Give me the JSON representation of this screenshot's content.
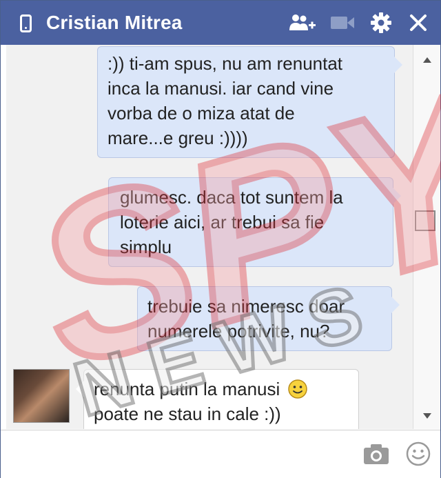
{
  "header": {
    "contact_name": "Cristian Mitrea",
    "icons": [
      "phone-icon",
      "add-friend-icon",
      "video-icon",
      "gear-icon",
      "close-icon"
    ]
  },
  "messages": [
    {
      "direction": "outgoing",
      "lines": [
        ":)) ti-am spus, nu am renuntat",
        "inca la manusi. iar cand vine",
        "vorba de o miza atat de",
        "mare...e greu :))))"
      ]
    },
    {
      "direction": "outgoing",
      "lines": [
        "glumesc. daca tot suntem la",
        "loterie aici, ar trebui sa fie",
        "simplu"
      ]
    },
    {
      "direction": "outgoing",
      "lines": [
        "trebuie sa nimeresc doar",
        "numerele potrivite, nu?"
      ]
    },
    {
      "direction": "incoming",
      "lines": [
        "renunta putin la manusi",
        "poate ne stau in cale :))"
      ]
    }
  ],
  "composer": {
    "value": "",
    "icons": [
      "camera-icon",
      "emoji-icon"
    ]
  },
  "watermark": {
    "brand": "SPY",
    "sub": "NEWS"
  },
  "colors": {
    "header": "#4b61a0",
    "outgoing_bubble": "#dbe6f9",
    "watermark": "#e0323a"
  }
}
